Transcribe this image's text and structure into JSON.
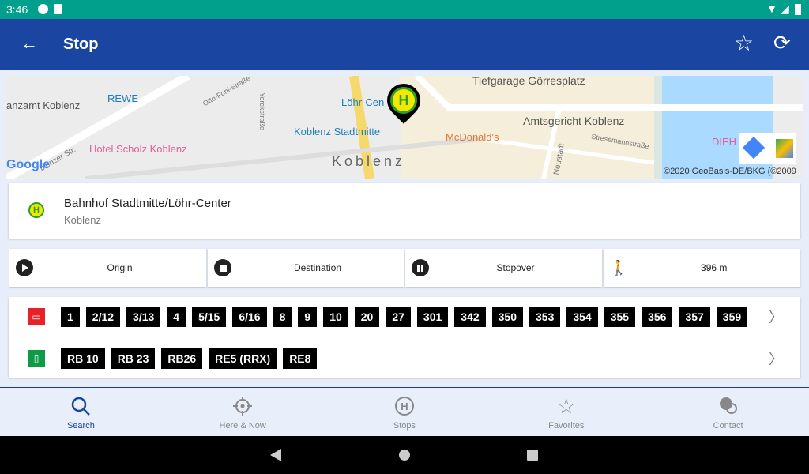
{
  "status_bar": {
    "time": "3:46"
  },
  "app_bar": {
    "title": "Stop",
    "back_icon": "arrow-left-icon",
    "favorite_icon": "star-outline-icon",
    "refresh_icon": "refresh-icon"
  },
  "map": {
    "labels": [
      "Tiefgarage Görresplatz",
      "Löhr-Cen",
      "REWE",
      "anzamt Koblenz",
      "Koblenz Stadtmitte",
      "McDonald's",
      "Amtsgericht Koblenz",
      "Hotel Scholz Koblenz",
      "Koblenz",
      "DIEH",
      "Otto-Fohl-Straße",
      "Yorckstraße",
      "Stresemannstraße",
      "Neustadt",
      "blenzer Str."
    ],
    "google_logo": "Google",
    "copyright": "©2020 GeoBasis-DE/BKG (©2009"
  },
  "stop": {
    "name": "Bahnhof Stadtmitte/Löhr-Center",
    "city": "Koblenz"
  },
  "actions": [
    {
      "label": "Origin",
      "icon": "play-icon"
    },
    {
      "label": "Destination",
      "icon": "stop-icon"
    },
    {
      "label": "Stopover",
      "icon": "pause-icon"
    },
    {
      "label": "396 m",
      "icon": "walk-icon"
    }
  ],
  "lines": {
    "bus": [
      "1",
      "2/12",
      "3/13",
      "4",
      "5/15",
      "6/16",
      "8",
      "9",
      "10",
      "20",
      "27",
      "301",
      "342",
      "350",
      "353",
      "354",
      "355",
      "356",
      "357",
      "359"
    ],
    "train": [
      "RB 10",
      "RB 23",
      "RB26",
      "RE5 (RRX)",
      "RE8"
    ]
  },
  "colors": {
    "bus": "#e8202a",
    "train": "#0f9a48",
    "accent": "#1a45a0"
  },
  "bottom_nav": [
    {
      "label": "Search",
      "active": true
    },
    {
      "label": "Here & Now"
    },
    {
      "label": "Stops"
    },
    {
      "label": "Favorites"
    },
    {
      "label": "Contact"
    }
  ]
}
